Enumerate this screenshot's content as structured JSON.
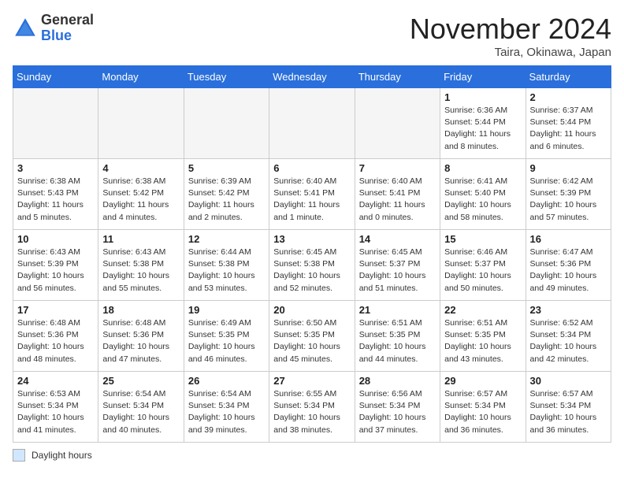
{
  "header": {
    "logo_general": "General",
    "logo_blue": "Blue",
    "month_title": "November 2024",
    "subtitle": "Taira, Okinawa, Japan"
  },
  "days_of_week": [
    "Sunday",
    "Monday",
    "Tuesday",
    "Wednesday",
    "Thursday",
    "Friday",
    "Saturday"
  ],
  "legend": {
    "label": "Daylight hours"
  },
  "weeks": [
    {
      "days": [
        {
          "num": "",
          "info": ""
        },
        {
          "num": "",
          "info": ""
        },
        {
          "num": "",
          "info": ""
        },
        {
          "num": "",
          "info": ""
        },
        {
          "num": "",
          "info": ""
        },
        {
          "num": "1",
          "info": "Sunrise: 6:36 AM\nSunset: 5:44 PM\nDaylight: 11 hours and 8 minutes."
        },
        {
          "num": "2",
          "info": "Sunrise: 6:37 AM\nSunset: 5:44 PM\nDaylight: 11 hours and 6 minutes."
        }
      ]
    },
    {
      "days": [
        {
          "num": "3",
          "info": "Sunrise: 6:38 AM\nSunset: 5:43 PM\nDaylight: 11 hours and 5 minutes."
        },
        {
          "num": "4",
          "info": "Sunrise: 6:38 AM\nSunset: 5:42 PM\nDaylight: 11 hours and 4 minutes."
        },
        {
          "num": "5",
          "info": "Sunrise: 6:39 AM\nSunset: 5:42 PM\nDaylight: 11 hours and 2 minutes."
        },
        {
          "num": "6",
          "info": "Sunrise: 6:40 AM\nSunset: 5:41 PM\nDaylight: 11 hours and 1 minute."
        },
        {
          "num": "7",
          "info": "Sunrise: 6:40 AM\nSunset: 5:41 PM\nDaylight: 11 hours and 0 minutes."
        },
        {
          "num": "8",
          "info": "Sunrise: 6:41 AM\nSunset: 5:40 PM\nDaylight: 10 hours and 58 minutes."
        },
        {
          "num": "9",
          "info": "Sunrise: 6:42 AM\nSunset: 5:39 PM\nDaylight: 10 hours and 57 minutes."
        }
      ]
    },
    {
      "days": [
        {
          "num": "10",
          "info": "Sunrise: 6:43 AM\nSunset: 5:39 PM\nDaylight: 10 hours and 56 minutes."
        },
        {
          "num": "11",
          "info": "Sunrise: 6:43 AM\nSunset: 5:38 PM\nDaylight: 10 hours and 55 minutes."
        },
        {
          "num": "12",
          "info": "Sunrise: 6:44 AM\nSunset: 5:38 PM\nDaylight: 10 hours and 53 minutes."
        },
        {
          "num": "13",
          "info": "Sunrise: 6:45 AM\nSunset: 5:38 PM\nDaylight: 10 hours and 52 minutes."
        },
        {
          "num": "14",
          "info": "Sunrise: 6:45 AM\nSunset: 5:37 PM\nDaylight: 10 hours and 51 minutes."
        },
        {
          "num": "15",
          "info": "Sunrise: 6:46 AM\nSunset: 5:37 PM\nDaylight: 10 hours and 50 minutes."
        },
        {
          "num": "16",
          "info": "Sunrise: 6:47 AM\nSunset: 5:36 PM\nDaylight: 10 hours and 49 minutes."
        }
      ]
    },
    {
      "days": [
        {
          "num": "17",
          "info": "Sunrise: 6:48 AM\nSunset: 5:36 PM\nDaylight: 10 hours and 48 minutes."
        },
        {
          "num": "18",
          "info": "Sunrise: 6:48 AM\nSunset: 5:36 PM\nDaylight: 10 hours and 47 minutes."
        },
        {
          "num": "19",
          "info": "Sunrise: 6:49 AM\nSunset: 5:35 PM\nDaylight: 10 hours and 46 minutes."
        },
        {
          "num": "20",
          "info": "Sunrise: 6:50 AM\nSunset: 5:35 PM\nDaylight: 10 hours and 45 minutes."
        },
        {
          "num": "21",
          "info": "Sunrise: 6:51 AM\nSunset: 5:35 PM\nDaylight: 10 hours and 44 minutes."
        },
        {
          "num": "22",
          "info": "Sunrise: 6:51 AM\nSunset: 5:35 PM\nDaylight: 10 hours and 43 minutes."
        },
        {
          "num": "23",
          "info": "Sunrise: 6:52 AM\nSunset: 5:34 PM\nDaylight: 10 hours and 42 minutes."
        }
      ]
    },
    {
      "days": [
        {
          "num": "24",
          "info": "Sunrise: 6:53 AM\nSunset: 5:34 PM\nDaylight: 10 hours and 41 minutes."
        },
        {
          "num": "25",
          "info": "Sunrise: 6:54 AM\nSunset: 5:34 PM\nDaylight: 10 hours and 40 minutes."
        },
        {
          "num": "26",
          "info": "Sunrise: 6:54 AM\nSunset: 5:34 PM\nDaylight: 10 hours and 39 minutes."
        },
        {
          "num": "27",
          "info": "Sunrise: 6:55 AM\nSunset: 5:34 PM\nDaylight: 10 hours and 38 minutes."
        },
        {
          "num": "28",
          "info": "Sunrise: 6:56 AM\nSunset: 5:34 PM\nDaylight: 10 hours and 37 minutes."
        },
        {
          "num": "29",
          "info": "Sunrise: 6:57 AM\nSunset: 5:34 PM\nDaylight: 10 hours and 36 minutes."
        },
        {
          "num": "30",
          "info": "Sunrise: 6:57 AM\nSunset: 5:34 PM\nDaylight: 10 hours and 36 minutes."
        }
      ]
    }
  ]
}
